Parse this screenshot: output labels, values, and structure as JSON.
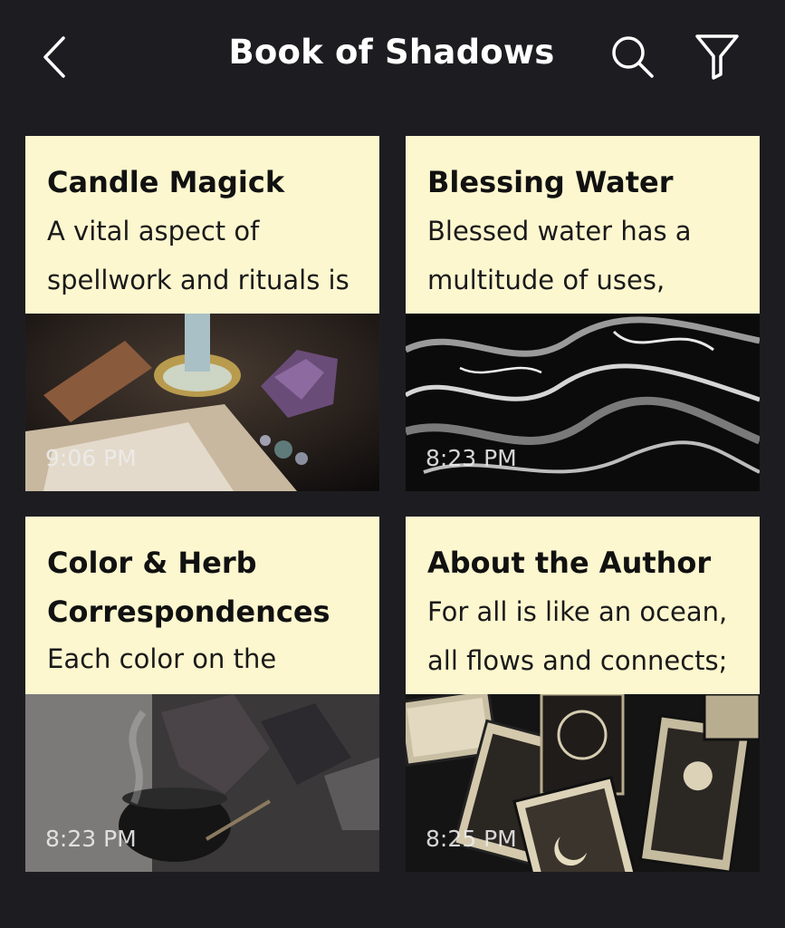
{
  "header": {
    "title": "Book of Shadows",
    "back_icon": "chevron-left-icon",
    "search_icon": "search-icon",
    "filter_icon": "filter-icon"
  },
  "colors": {
    "background": "#1d1d21",
    "card_background": "#fdf7cf",
    "title_text": "#ffffff"
  },
  "cards": [
    {
      "title": "Candle Magick",
      "excerpt_lines": [
        "A vital aspect of",
        "spellwork and rituals is"
      ],
      "time": "9:06 PM",
      "image": "candle-crystals-image"
    },
    {
      "title": "Blessing Water",
      "excerpt_lines": [
        "Blessed water has a",
        "multitude of uses,"
      ],
      "time": "8:23 PM",
      "image": "dark-water-ripples-image"
    },
    {
      "title_lines": [
        "Color & Herb",
        "Correspondences"
      ],
      "excerpt_lines": [
        "Each color on the"
      ],
      "time": "8:23 PM",
      "image": "cauldron-crystals-image"
    },
    {
      "title": "About the Author",
      "excerpt_lines": [
        "For all is like an ocean,",
        "all flows and connects;"
      ],
      "time": "8:25 PM",
      "image": "tarot-cards-image"
    }
  ]
}
